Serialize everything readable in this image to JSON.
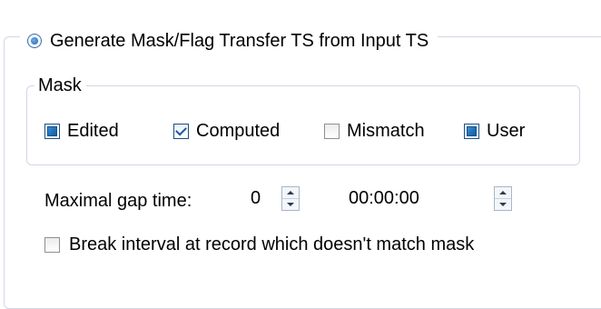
{
  "generate_option": {
    "label": "Generate Mask/Flag Transfer TS from Input TS",
    "selected": true
  },
  "mask_group": {
    "title": "Mask",
    "items": [
      {
        "label": "Edited",
        "state": "indeterminate"
      },
      {
        "label": "Computed",
        "state": "checked"
      },
      {
        "label": "Mismatch",
        "state": "unchecked"
      },
      {
        "label": "User",
        "state": "indeterminate"
      }
    ]
  },
  "gap": {
    "label": "Maximal gap time:",
    "count_value": "0",
    "time_value": "00:00:00"
  },
  "break_option": {
    "label": "Break interval at record which doesn't match mask",
    "checked": false
  },
  "colors": {
    "accent": "#1e6fb8",
    "group_border": "#d0d7e5"
  }
}
